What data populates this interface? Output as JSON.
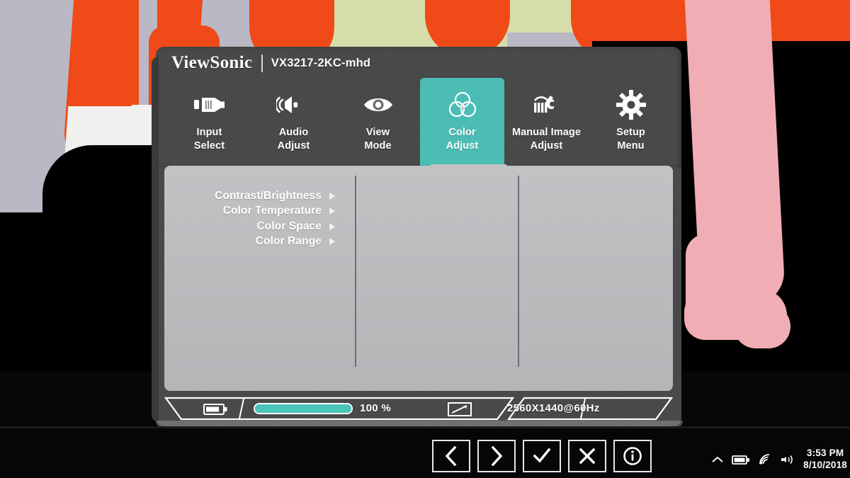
{
  "osd": {
    "brand": "ViewSonic",
    "model": "VX3217-2KC-mhd",
    "accent_color": "#4bbdb5",
    "panel_color": "#484848",
    "content_color": "#bcbcbf",
    "tabs": [
      {
        "label_line1": "Input",
        "label_line2": "Select",
        "icon": "video-input-icon",
        "selected": false
      },
      {
        "label_line1": "Audio",
        "label_line2": "Adjust",
        "icon": "speaker-icon",
        "selected": false
      },
      {
        "label_line1": "View",
        "label_line2": "Mode",
        "icon": "eye-icon",
        "selected": false
      },
      {
        "label_line1": "Color",
        "label_line2": "Adjust",
        "icon": "color-circles-icon",
        "selected": true
      },
      {
        "label_line1": "Manual Image",
        "label_line2": "Adjust",
        "icon": "wrench-icon",
        "selected": false
      },
      {
        "label_line1": "Setup",
        "label_line2": "Menu",
        "icon": "gear-icon",
        "selected": false
      }
    ],
    "menu_items": [
      {
        "label": "Contrast/Brightness",
        "arrow": "submenu-arrow-icon"
      },
      {
        "label": "Color Temperature",
        "arrow": "submenu-arrow-icon"
      },
      {
        "label": "Color Space",
        "arrow": "submenu-arrow-icon"
      },
      {
        "label": "Color Range",
        "arrow": "submenu-arrow-icon"
      }
    ],
    "statusbar": {
      "contrast_icon": "battery-contrast-icon",
      "percent": "100 %",
      "bar_fill_percent": 100,
      "display_icon": "display-diagonal-icon",
      "resolution": "2560X1440@60Hz"
    }
  },
  "taskbar": {
    "osd_buttons": [
      {
        "name": "prev-button",
        "icon": "chevron-left-icon"
      },
      {
        "name": "next-button",
        "icon": "chevron-right-icon"
      },
      {
        "name": "confirm-button",
        "icon": "check-icon"
      },
      {
        "name": "close-button",
        "icon": "close-x-icon"
      },
      {
        "name": "info-button",
        "icon": "info-circle-icon"
      }
    ],
    "tray": {
      "expand_icon": "chevron-up-icon",
      "battery_icon": "battery-icon",
      "wifi_icon": "wifi-icon",
      "volume_icon": "volume-icon",
      "time": "3:53 PM",
      "date": "8/10/2018"
    }
  }
}
